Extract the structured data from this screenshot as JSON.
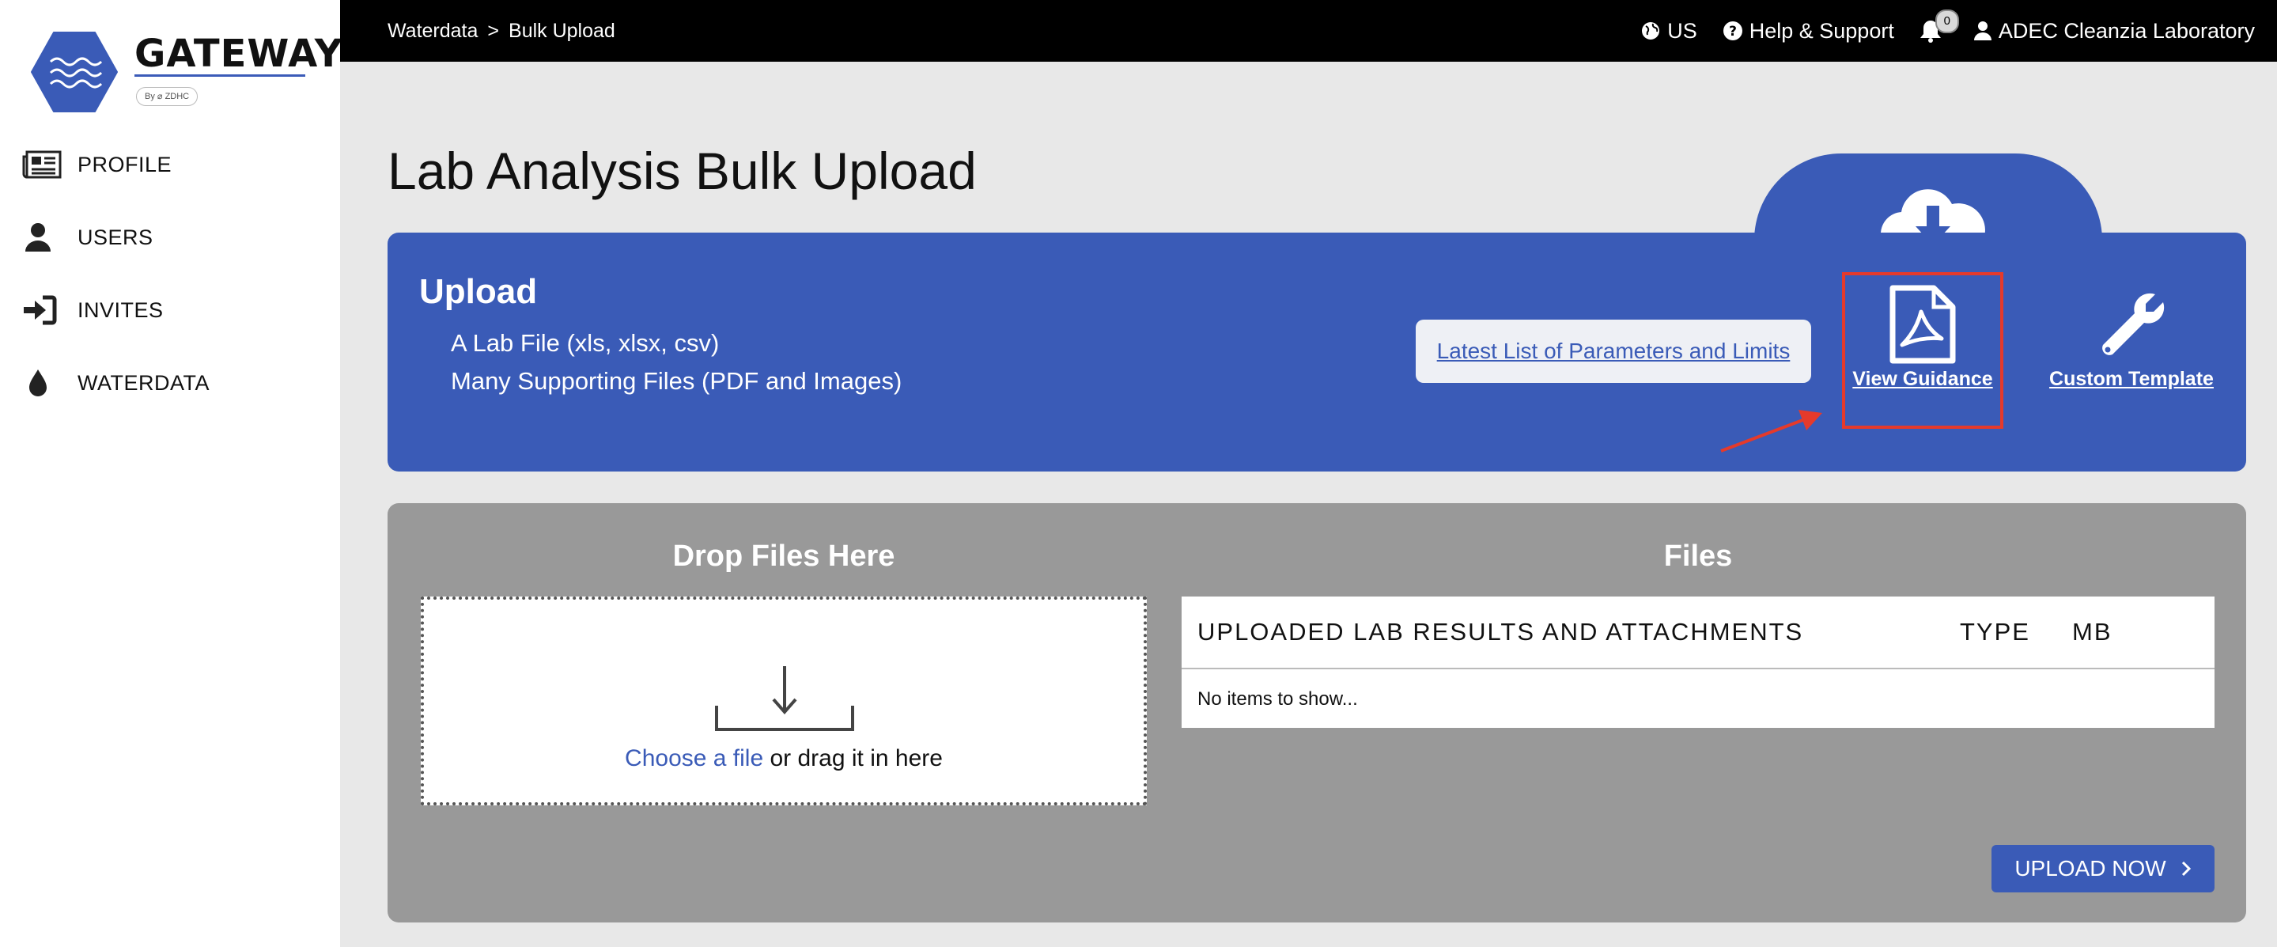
{
  "brand": {
    "name": "GATEWAY",
    "byline": "By ⌀ ZDHC",
    "color": "#3a5bb7"
  },
  "sidebar": {
    "items": [
      {
        "label": "PROFILE",
        "icon": "newspaper-icon"
      },
      {
        "label": "USERS",
        "icon": "user-icon"
      },
      {
        "label": "INVITES",
        "icon": "sign-in-icon"
      },
      {
        "label": "WATERDATA",
        "icon": "water-drop-icon"
      }
    ]
  },
  "topbar": {
    "breadcrumb": [
      "Waterdata",
      "Bulk Upload"
    ],
    "breadcrumb_separator": ">",
    "region": "US",
    "help": "Help & Support",
    "notifications": "0",
    "account": "ADEC Cleanzia Laboratory"
  },
  "page": {
    "title": "Lab Analysis Bulk Upload"
  },
  "upload_panel": {
    "title": "Upload",
    "lines": [
      "A Lab File (xls, xlsx, csv)",
      "Many Supporting Files (PDF and Images)"
    ],
    "params_link": "Latest List of Parameters and Limits",
    "view_guidance": "View Guidance",
    "custom_template": "Custom Template"
  },
  "drop_section": {
    "title": "Drop Files Here",
    "choose_link": "Choose a file",
    "drag_text": " or drag it in here"
  },
  "files_section": {
    "title": "Files",
    "columns": [
      "UPLOADED LAB RESULTS AND ATTACHMENTS",
      "TYPE",
      "MB"
    ],
    "empty_text": "No items to show..."
  },
  "actions": {
    "upload_now": "UPLOAD NOW"
  }
}
